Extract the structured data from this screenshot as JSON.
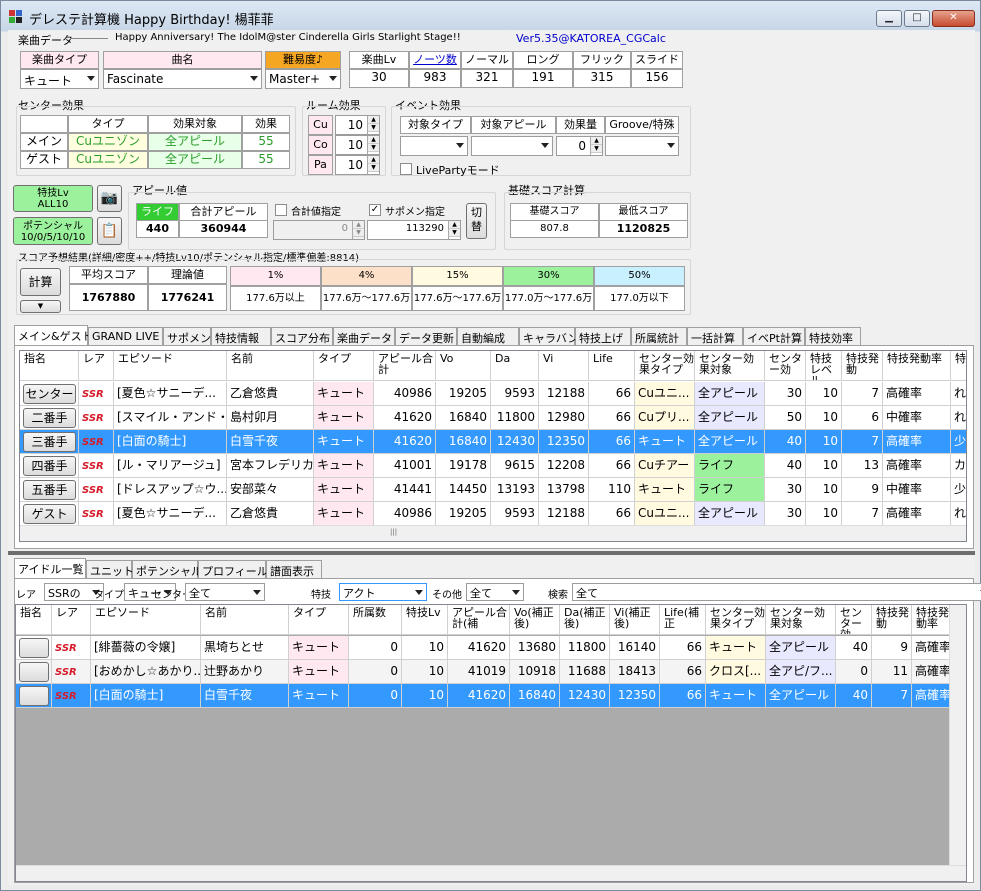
{
  "window": {
    "title": "デレステ計算機 Happy Birthday! 楊菲菲"
  },
  "song": {
    "group_label": "楽曲データ",
    "anniv": "Happy Anniversary! The IdolM@ster Cinderella Girls Starlight Stage!!",
    "version": "Ver5.35@KATOREA_CGCalc",
    "type_label": "楽曲タイプ",
    "type_value": "キュート",
    "name_label": "曲名",
    "name_value": "Fascinate",
    "diff_label": "難易度♪",
    "diff_value": "Master+",
    "stats_headers": [
      "楽曲Lv",
      "ノーツ数",
      "ノーマル",
      "ロング",
      "フリック",
      "スライド"
    ],
    "stats_values": [
      "30",
      "983",
      "321",
      "191",
      "315",
      "156"
    ]
  },
  "center": {
    "label": "センター効果",
    "headers": [
      "",
      "タイプ",
      "効果対象",
      "効果"
    ],
    "rows": [
      [
        "メイン",
        "Cuユニゾン",
        "全アピール",
        "55"
      ],
      [
        "ゲスト",
        "Cuユニゾン",
        "全アピール",
        "55"
      ]
    ]
  },
  "room": {
    "label": "ルーム効果",
    "rows": [
      [
        "Cu",
        "10"
      ],
      [
        "Co",
        "10"
      ],
      [
        "Pa",
        "10"
      ]
    ]
  },
  "event": {
    "label": "イベント効果",
    "headers": [
      "対象タイプ",
      "対象アピール",
      "効果量",
      "Groove/特殊"
    ],
    "amount": "0",
    "liveparty": "LivePartyモード"
  },
  "side": {
    "skill_lv": "特技Lv\nALL10",
    "skill_lv_a": "特技Lv",
    "skill_lv_b": "ALL10",
    "potential_a": "ポテンシャル",
    "potential_b": "10/0/5/10/10",
    "camera_icon": "camera-icon",
    "copy_icon": "copy-icon"
  },
  "appeal": {
    "label": "アピール値",
    "life_label": "ライフ",
    "total_label": "合計アピール",
    "life": "440",
    "total": "360944",
    "chk_total": "合計値指定",
    "chk_support": "サポメン指定",
    "total_input": "0",
    "support_input": "113290",
    "swap": "切替"
  },
  "base": {
    "label": "基礎スコア計算",
    "h1": "基礎スコア",
    "h2": "最低スコア",
    "v1": "807.8",
    "v2": "1120825"
  },
  "result": {
    "label": "スコア予想結果(詳細/密度++/特技Lv10/ポテンシャル指定/標準偏差:8814)",
    "calc": "計算",
    "avg_label": "平均スコア",
    "theo_label": "理論値",
    "avg": "1767880",
    "theo": "1776241",
    "pct_headers": [
      "1%",
      "4%",
      "15%",
      "30%",
      "50%"
    ],
    "pct_values": [
      "177.6万以上",
      "177.6万〜177.6万",
      "177.6万〜177.6万",
      "177.0万〜177.6万",
      "177.0万以下"
    ]
  },
  "tabs_top": [
    "メイン&ゲスト",
    "GRAND LIVE",
    "サポメン",
    "特技情報",
    "スコア分布",
    "楽曲データ",
    "データ更新",
    "自動編成",
    "キャラバン",
    "特技上げ",
    "所属統計",
    "一括計算",
    "イベPt計算",
    "特技効率"
  ],
  "unit_grid": {
    "headers": [
      "指名",
      "レア",
      "エピソード",
      "名前",
      "タイプ",
      "アピール合計",
      "Vo",
      "Da",
      "Vi",
      "Life",
      "センター効果タイプ",
      "センター効果対象",
      "センター効",
      "特技レベル",
      "特技発動",
      "特技発動率",
      "特"
    ],
    "rows": [
      [
        "センター",
        "SSR",
        "[夏色☆サニーデ...",
        "乙倉悠貴",
        "キュート",
        "40986",
        "19205",
        "9593",
        "12188",
        "66",
        "Cuユニ...",
        "全アピール",
        "30",
        "10",
        "7",
        "高確率",
        "れ"
      ],
      [
        "二番手",
        "SSR",
        "[スマイル・アンド・...",
        "島村卯月",
        "キュート",
        "41620",
        "16840",
        "11800",
        "12980",
        "66",
        "Cuプリ...",
        "全アピール",
        "50",
        "10",
        "6",
        "中確率",
        "れ"
      ],
      [
        "三番手",
        "SSR",
        "[白面の騎士]",
        "白雪千夜",
        "キュート",
        "41620",
        "16840",
        "12430",
        "12350",
        "66",
        "キュート",
        "全アピール",
        "40",
        "10",
        "7",
        "高確率",
        "少"
      ],
      [
        "四番手",
        "SSR",
        "[ル・マリアージュ]",
        "宮本フレデリカ",
        "キュート",
        "41001",
        "19178",
        "9615",
        "12208",
        "66",
        "Cuチアー",
        "ライフ",
        "40",
        "10",
        "13",
        "高確率",
        "カ"
      ],
      [
        "五番手",
        "SSR",
        "[ドレスアップ☆ウ...",
        "安部菜々",
        "キュート",
        "41441",
        "14450",
        "13193",
        "13798",
        "110",
        "キュート",
        "ライフ",
        "30",
        "10",
        "9",
        "中確率",
        "少"
      ],
      [
        "ゲスト",
        "SSR",
        "[夏色☆サニーデ...",
        "乙倉悠貴",
        "キュート",
        "40986",
        "19205",
        "9593",
        "12188",
        "66",
        "Cuユニ...",
        "全アピール",
        "30",
        "10",
        "7",
        "高確率",
        "れ"
      ]
    ]
  },
  "tabs_bottom": [
    "アイドル一覧",
    "ユニット",
    "ポテンシャル",
    "プロフィール",
    "譜面表示"
  ],
  "filter": {
    "rare_l": "レア",
    "rare_v": "SSRの",
    "type_l": "タイプ",
    "type_v": "キュー",
    "center_l": "センター",
    "center_v": "全て",
    "skill_l": "特技",
    "skill_v": "アクト",
    "other_l": "その他",
    "other_v": "全て",
    "search_l": "検索",
    "search_v": "全て"
  },
  "idol_grid": {
    "headers": [
      "指名",
      "レア",
      "エピソード",
      "名前",
      "タイプ",
      "所属数",
      "特技Lv",
      "アピール合計(補",
      "Vo(補正後)",
      "Da(補正後)",
      "Vi(補正後)",
      "Life(補正",
      "センター効果タイプ",
      "センター効果対象",
      "センター効",
      "特技発動",
      "特技発動率"
    ],
    "rows": [
      [
        "",
        "SSR",
        "[緋薔薇の令嬢]",
        "黒埼ちとせ",
        "キュート",
        "0",
        "10",
        "41620",
        "13680",
        "11800",
        "16140",
        "66",
        "キュート",
        "全アピール",
        "40",
        "9",
        "高確率"
      ],
      [
        "",
        "SSR",
        "[おめかし☆あかり...",
        "辻野あかり",
        "キュート",
        "0",
        "10",
        "41019",
        "10918",
        "11688",
        "18413",
        "66",
        "クロス[...",
        "全アピ/フ...",
        "0",
        "11",
        "高確率"
      ],
      [
        "",
        "SSR",
        "[白面の騎士]",
        "白雪千夜",
        "キュート",
        "0",
        "10",
        "41620",
        "16840",
        "12430",
        "12350",
        "66",
        "キュート",
        "全アピール",
        "40",
        "7",
        "高確率"
      ]
    ]
  },
  "colors": {
    "accent": "#3399ff",
    "diff": "#f5a623",
    "life": "#33cc33"
  }
}
